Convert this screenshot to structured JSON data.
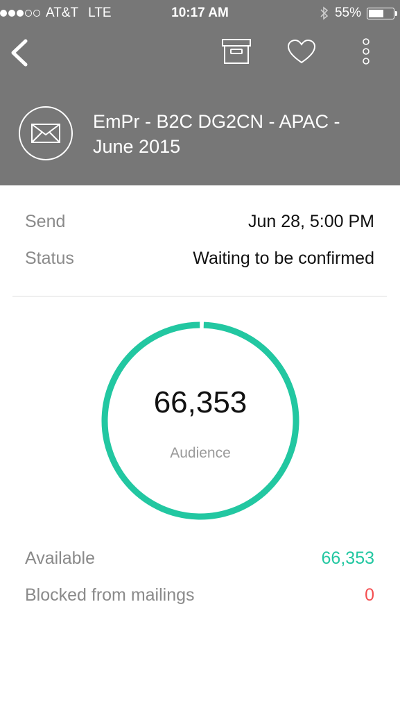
{
  "status_bar": {
    "carrier": "AT&T",
    "network": "LTE",
    "time": "10:17 AM",
    "battery": "55%",
    "battery_level": 0.55,
    "signal_bars": 3,
    "signal_max": 5
  },
  "toolbar": {
    "back_icon": "chevron-left-icon",
    "archive_icon": "archive-box-icon",
    "favorite_icon": "heart-icon",
    "more_icon": "vertical-dots-icon"
  },
  "campaign": {
    "icon": "envelope-icon",
    "title": "EmPr - B2C DG2CN - APAC - June 2015"
  },
  "details": {
    "send_label": "Send",
    "send_value": "Jun 28, 5:00 PM",
    "status_label": "Status",
    "status_value": "Waiting to be confirmed"
  },
  "audience": {
    "count": "66,353",
    "label": "Audience",
    "available_fraction": 1.0
  },
  "breakdown": {
    "available_label": "Available",
    "available_value": "66,353",
    "blocked_label": "Blocked from mailings",
    "blocked_value": "0"
  },
  "colors": {
    "header_bg": "#777777",
    "accent_green": "#22c7a1",
    "alert_red": "#f44e50"
  }
}
